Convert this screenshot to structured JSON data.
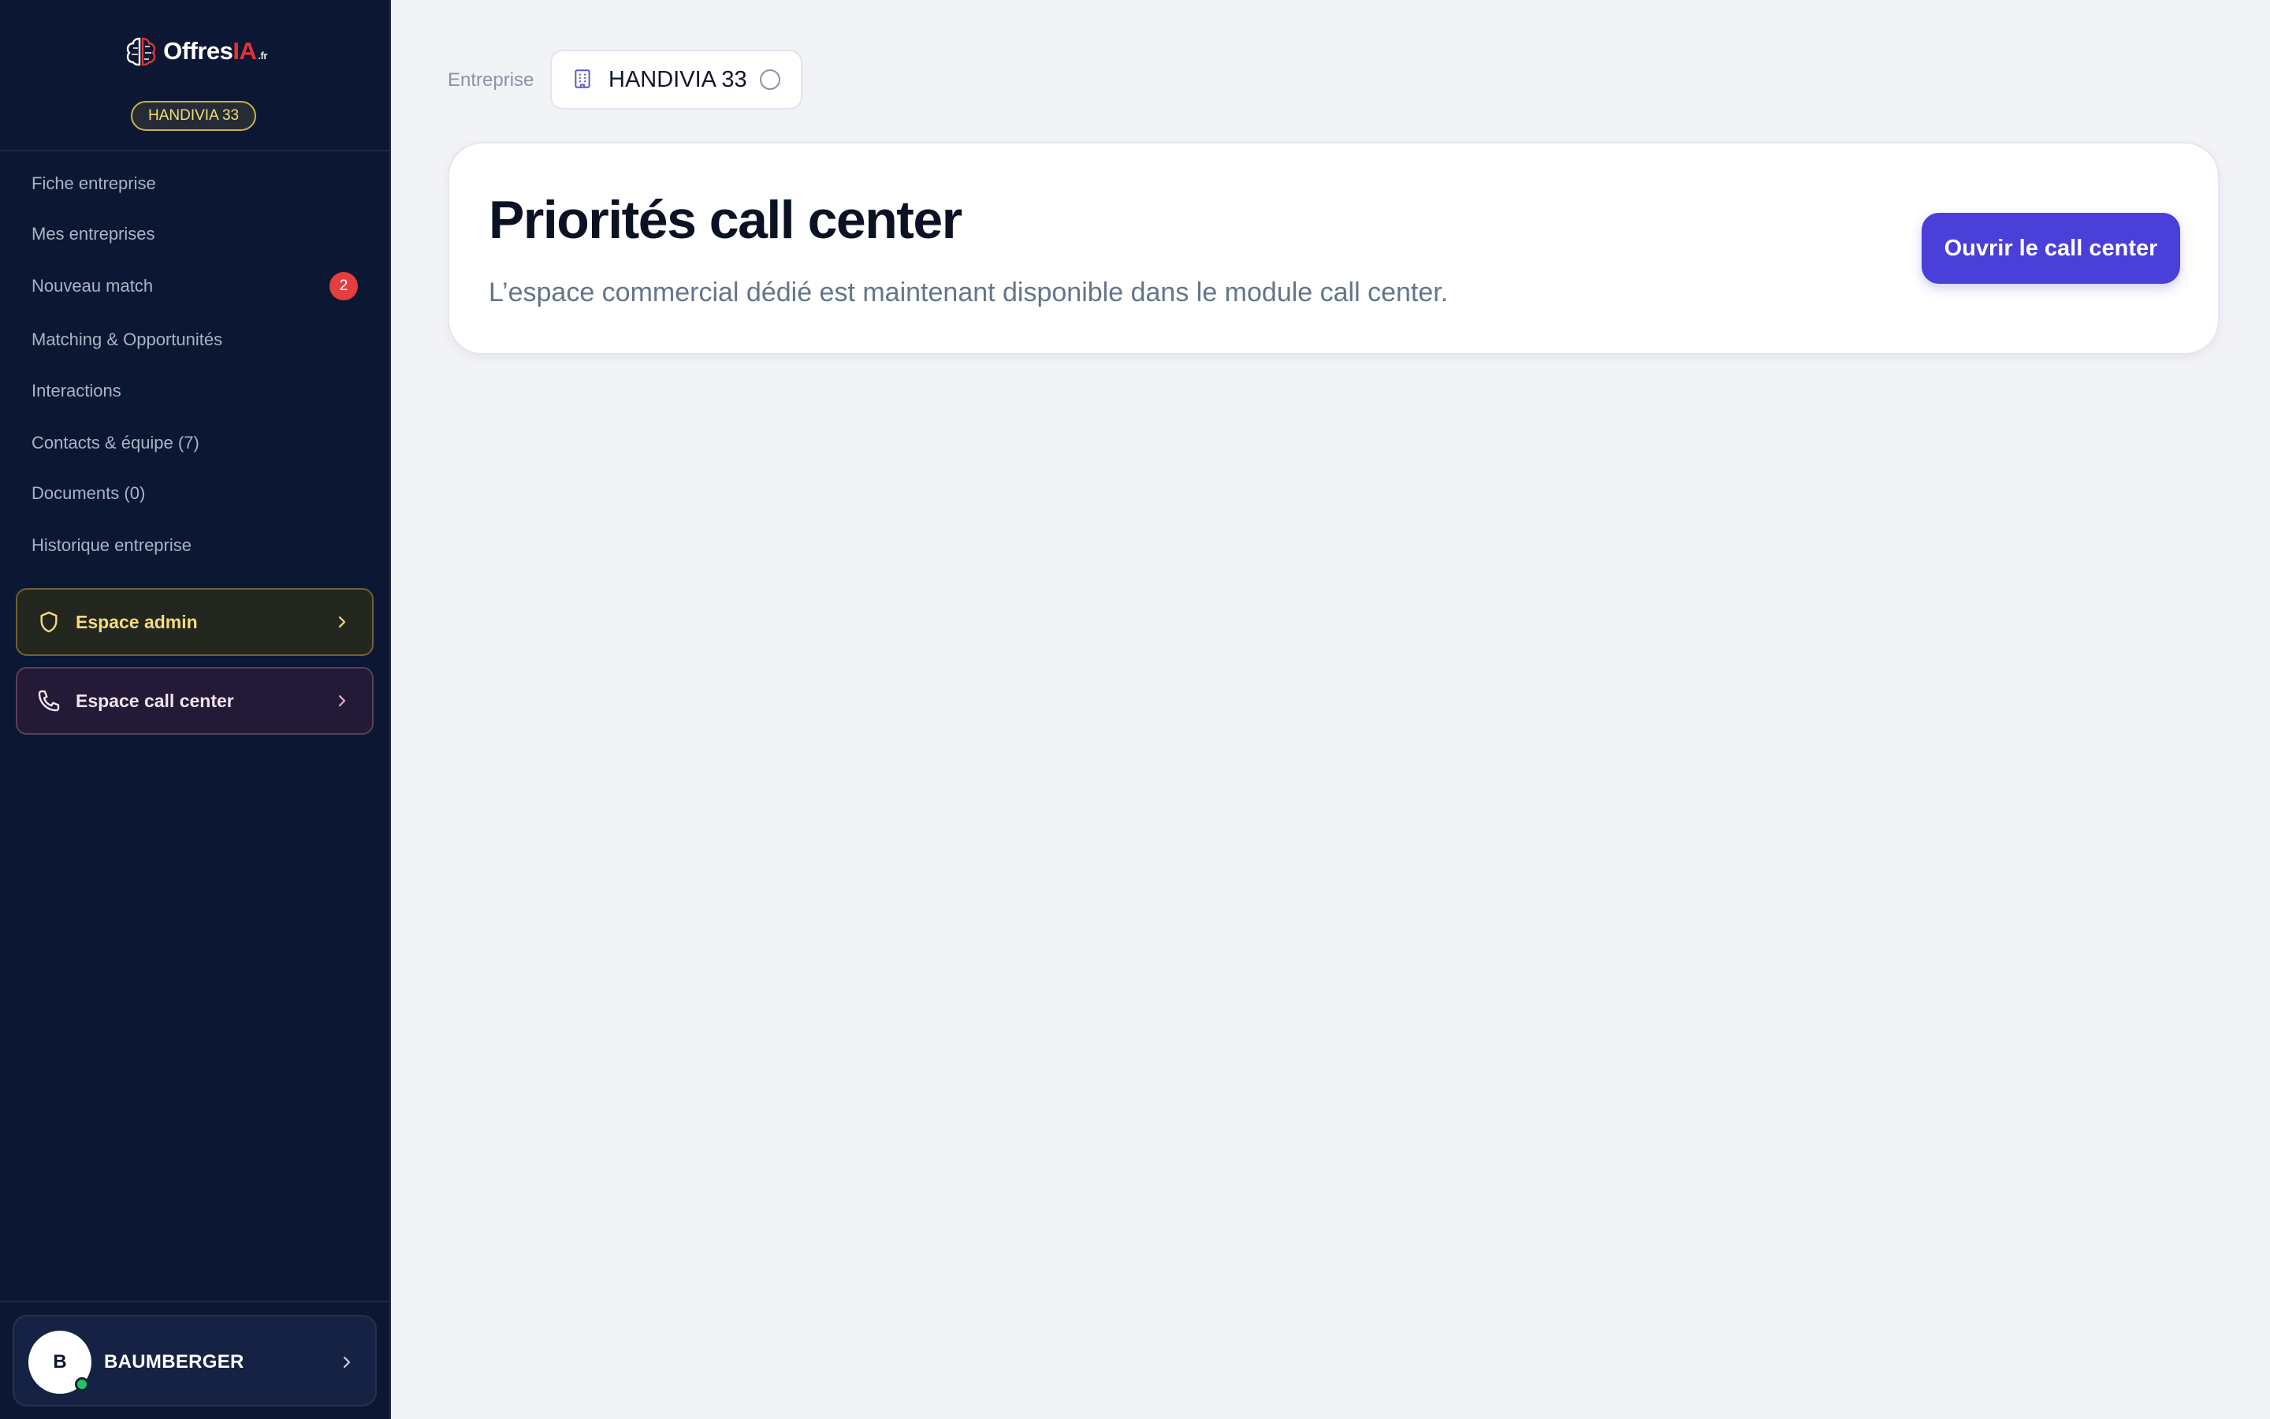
{
  "sidebar": {
    "logo": {
      "brand_main": "Offres",
      "brand_accent": "IA",
      "brand_tld": ".fr"
    },
    "company_badge": "HANDIVIA 33",
    "nav_items": [
      {
        "label": "Fiche entreprise"
      },
      {
        "label": "Mes entreprises"
      },
      {
        "label": "Nouveau match",
        "badge": "2"
      },
      {
        "label": "Matching & Opportunités"
      },
      {
        "label": "Interactions"
      },
      {
        "label": "Contacts & équipe (7)"
      },
      {
        "label": "Documents (0)"
      },
      {
        "label": "Historique entreprise"
      }
    ],
    "admin_space": {
      "label": "Espace admin",
      "icon": "shield-icon"
    },
    "callcenter_space": {
      "label": "Espace call center",
      "icon": "phone-icon"
    },
    "user": {
      "initial": "B",
      "name": "BAUMBERGER",
      "status": "online"
    }
  },
  "header": {
    "entreprise_label": "Entreprise",
    "selected_company": "HANDIVIA 33"
  },
  "main": {
    "card": {
      "title": "Priorités call center",
      "subtitle": "L’espace commercial dédié est maintenant disponible dans le module call center.",
      "button_label": "Ouvrir le call center"
    }
  },
  "colors": {
    "sidebar_bg": "#0c1733",
    "accent": "#4a3fd8",
    "admin_gold": "#f4dc7e",
    "badge_red": "#e53e3e",
    "status_green": "#22c55e"
  }
}
